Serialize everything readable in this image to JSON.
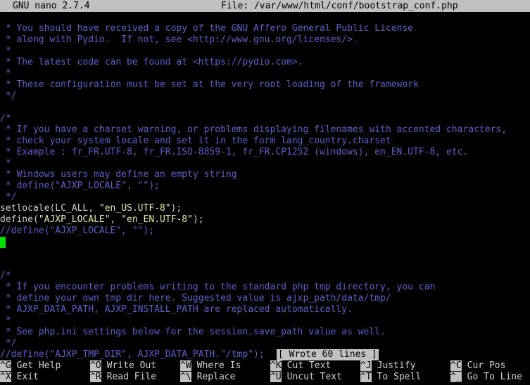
{
  "titlebar": {
    "app": "GNU nano 2.7.4",
    "file": "File: /var/www/html/conf/bootstrap_conf.php"
  },
  "editor": {
    "lines": [
      [
        {
          "t": " * You should have received a copy of the GNU Affero General Public License",
          "c": "comment"
        }
      ],
      [
        {
          "t": " * along with Pydio.  If not, see <http://www.gnu.org/licenses/>.",
          "c": "comment"
        }
      ],
      [
        {
          "t": " *",
          "c": "comment"
        }
      ],
      [
        {
          "t": " * The latest code can be found at <https://pydio.com>.",
          "c": "comment"
        }
      ],
      [
        {
          "t": " *",
          "c": "comment"
        }
      ],
      [
        {
          "t": " * These configuration must be set at the very root loading of the framework",
          "c": "comment"
        }
      ],
      [
        {
          "t": " */",
          "c": "comment"
        }
      ],
      [],
      [
        {
          "t": "/*",
          "c": "comment"
        }
      ],
      [
        {
          "t": " * If you have a charset warning, or problems displaying filenames with accented characters,",
          "c": "comment"
        }
      ],
      [
        {
          "t": " * check your system locale and set it in the form lang_country.charset",
          "c": "comment"
        }
      ],
      [
        {
          "t": " * Example : fr_FR.UTF-8, fr_FR.ISO-8859-1, fr_FR.CP1252 (windows), en_EN.UTF-8, etc.",
          "c": "comment"
        }
      ],
      [
        {
          "t": " *",
          "c": "comment"
        }
      ],
      [
        {
          "t": " * Windows users may define an empty string",
          "c": "comment"
        }
      ],
      [
        {
          "t": " * define(\"AJXP_LOCALE\", \"\");",
          "c": "comment"
        }
      ],
      [
        {
          "t": " */",
          "c": "comment"
        }
      ],
      [
        {
          "t": "setlocale(LC_ALL, ",
          "c": "code"
        },
        {
          "t": "\"en_US.UTF-8\"",
          "c": "str"
        },
        {
          "t": ");",
          "c": "code"
        }
      ],
      [
        {
          "t": "define(",
          "c": "code"
        },
        {
          "t": "\"AJXP_LOCALE\"",
          "c": "str"
        },
        {
          "t": ", ",
          "c": "code"
        },
        {
          "t": "\"en_EN.UTF-8\"",
          "c": "str"
        },
        {
          "t": ");",
          "c": "code"
        }
      ],
      [
        {
          "t": "//define(\"AJXP_LOCALE\", \"\");",
          "c": "comment"
        }
      ],
      [
        {
          "cursor": true
        }
      ],
      [],
      [],
      [
        {
          "t": "/*",
          "c": "comment"
        }
      ],
      [
        {
          "t": " * If you encounter problems writing to the standard php tmp directory, you can",
          "c": "comment"
        }
      ],
      [
        {
          "t": " * define your own tmp dir here. Suggested value is ajxp_path/data/tmp/",
          "c": "comment"
        }
      ],
      [
        {
          "t": " * AJXP_DATA_PATH, AJXP_INSTALL_PATH are replaced automatically.",
          "c": "comment"
        }
      ],
      [
        {
          "t": " *",
          "c": "comment"
        }
      ],
      [
        {
          "t": " * See php.ini settings below for the session.save_path value as well.",
          "c": "comment"
        }
      ],
      [
        {
          "t": " */",
          "c": "comment"
        }
      ],
      [
        {
          "t": "//define(\"AJXP_TMP_DIR\", AJXP_DATA_PATH.\"/tmp\");",
          "c": "comment"
        }
      ]
    ]
  },
  "status": {
    "message": "[ Wrote 60 lines ]"
  },
  "shortcuts": {
    "row1": [
      {
        "key": "^G",
        "label": "Get Help"
      },
      {
        "key": "^O",
        "label": "Write Out"
      },
      {
        "key": "^W",
        "label": "Where Is"
      },
      {
        "key": "^K",
        "label": "Cut Text"
      },
      {
        "key": "^J",
        "label": "Justify"
      },
      {
        "key": "^C",
        "label": "Cur Pos"
      }
    ],
    "row2": [
      {
        "key": "^X",
        "label": "Exit"
      },
      {
        "key": "^R",
        "label": "Read File"
      },
      {
        "key": "^\\",
        "label": "Replace"
      },
      {
        "key": "^U",
        "label": "Uncut Text"
      },
      {
        "key": "^T",
        "label": "To Spell"
      },
      {
        "key": "^_",
        "label": "Go To Line"
      }
    ]
  },
  "colors": {
    "background": "#000000",
    "comment": "#5e5ec8",
    "code": "#d0d0d0",
    "string": "#e8e8a8",
    "cursor": "#00e000",
    "bar": "#c0c0c0"
  }
}
